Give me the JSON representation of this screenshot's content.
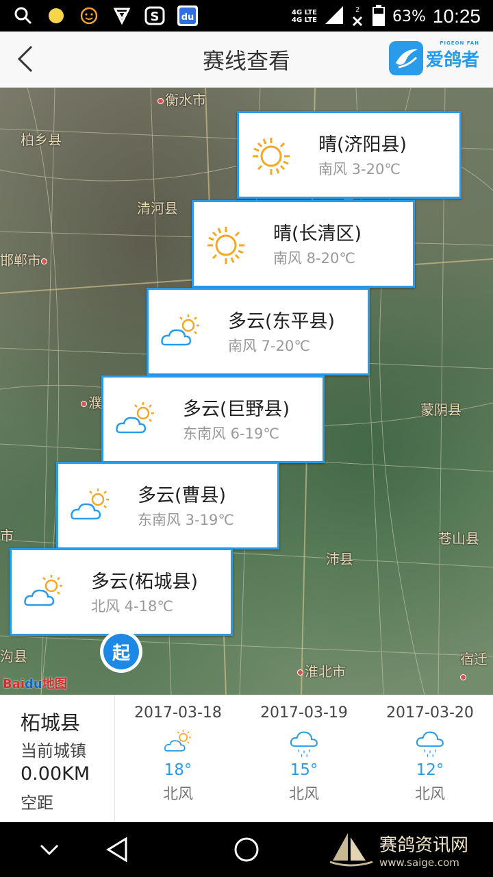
{
  "status_bar": {
    "network_top": "4G LTE",
    "network_bottom": "4G LTE",
    "sim2": "2",
    "battery": "63%",
    "time": "10:25"
  },
  "header": {
    "title": "赛线查看",
    "logo_text": "爱鸽者",
    "logo_sub": "PIGEON FAN"
  },
  "map": {
    "cities": [
      {
        "name": "衡水市"
      },
      {
        "name": "柏乡县"
      },
      {
        "name": "清河县"
      },
      {
        "name": "邯郸市"
      },
      {
        "name": "濮"
      },
      {
        "name": "蒙阴县"
      },
      {
        "name": "市"
      },
      {
        "name": "苍山县"
      },
      {
        "name": "沛县"
      },
      {
        "name": "沟县"
      },
      {
        "name": "淮北市"
      },
      {
        "name": "宿迁"
      }
    ],
    "weather_cards": [
      {
        "condition": "晴(济阳县)",
        "wind": "南风  3-20℃",
        "icon": "sun-icon"
      },
      {
        "condition": "晴(长清区)",
        "wind": "南风  8-20℃",
        "icon": "sun-icon"
      },
      {
        "condition": "多云(东平县)",
        "wind": "南风  7-20℃",
        "icon": "cloudy-icon"
      },
      {
        "condition": "多云(巨野县)",
        "wind": "东南风  6-19℃",
        "icon": "cloudy-icon"
      },
      {
        "condition": "多云(曹县)",
        "wind": "东南风  3-19℃",
        "icon": "cloudy-icon"
      },
      {
        "condition": "多云(柘城县)",
        "wind": "北风  4-18℃",
        "icon": "cloudy-icon"
      }
    ],
    "start_marker": "起",
    "baidu_bai": "Bai",
    "baidu_du": "du",
    "baidu_map": "地图"
  },
  "summary": {
    "city": "柘城县",
    "label": "当前城镇",
    "distance": "0.00KM",
    "distance_label": "空距"
  },
  "forecast": [
    {
      "date": "2017-03-18",
      "icon": "cloudy-icon",
      "temp": "18°",
      "wind": "北风"
    },
    {
      "date": "2017-03-19",
      "icon": "rain-icon",
      "temp": "15°",
      "wind": "北风"
    },
    {
      "date": "2017-03-20",
      "icon": "rain-icon",
      "temp": "12°",
      "wind": "北风"
    }
  ],
  "watermark": {
    "title": "赛鸽资讯网",
    "url": "www.saige.com"
  },
  "colors": {
    "accent": "#2a9be8",
    "sun": "#f5a623",
    "cloud": "#2a9be8"
  }
}
